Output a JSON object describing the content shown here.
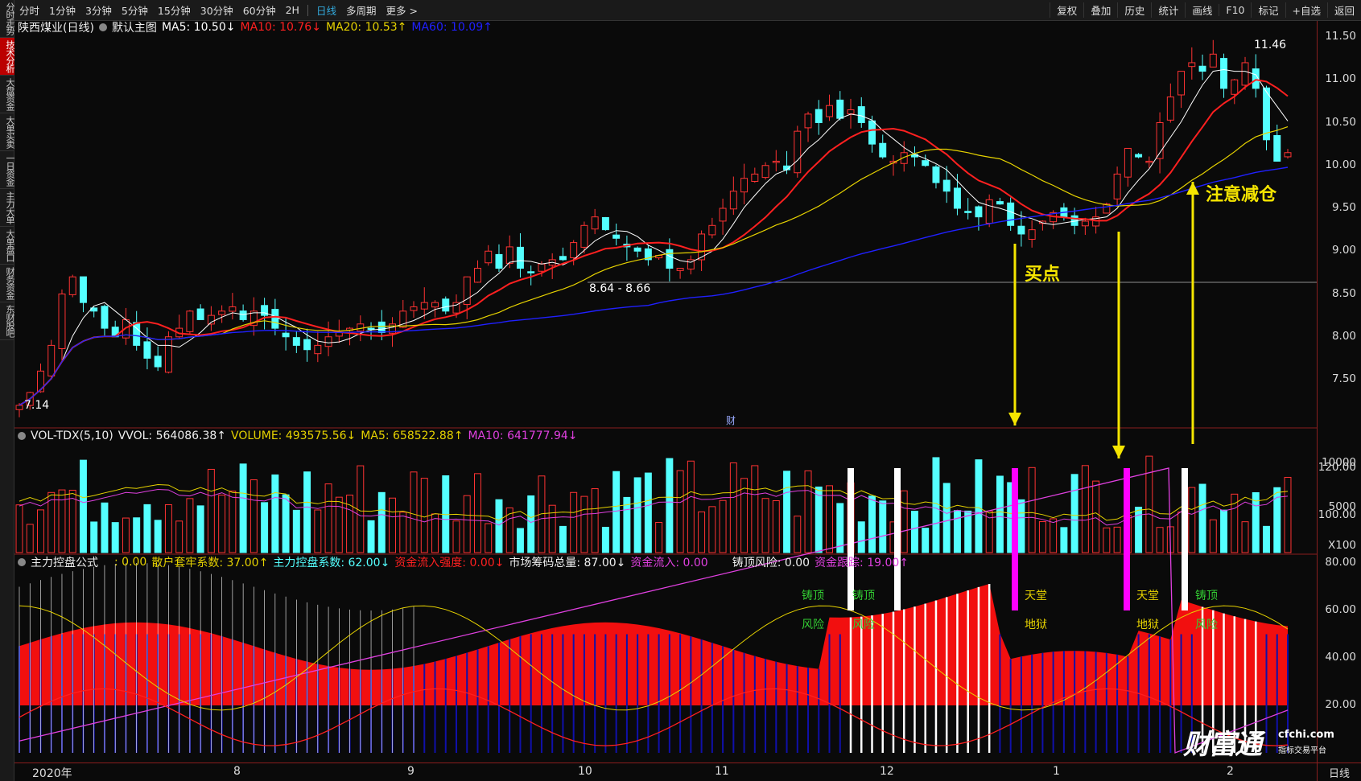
{
  "sidebar": {
    "tabs": [
      {
        "label": "分时走势",
        "active": false
      },
      {
        "label": "技术分析",
        "active": true
      },
      {
        "label": "大盘资金",
        "active": false
      },
      {
        "label": "大单买卖",
        "active": false
      },
      {
        "label": "一日资金",
        "active": false
      },
      {
        "label": "主力大单",
        "active": false
      },
      {
        "label": "大单盘口",
        "active": false
      },
      {
        "label": "财务资金",
        "active": false
      },
      {
        "label": "东财股吧",
        "active": false
      }
    ]
  },
  "toolbar": {
    "periods": [
      "分时",
      "1分钟",
      "3分钟",
      "5分钟",
      "15分钟",
      "30分钟",
      "60分钟",
      "2H",
      "日线",
      "多周期",
      "更多 >"
    ],
    "active_period": "日线",
    "tools": [
      "复权",
      "叠加",
      "历史",
      "统计",
      "画线",
      "F10",
      "标记",
      "+自选",
      "返回"
    ]
  },
  "main_legend": {
    "stock": "陕西煤业(日线)",
    "template": "默认主图",
    "ma5": "MA5: 10.50↓",
    "ma10": "MA10: 10.76↓",
    "ma20": "MA20: 10.53↑",
    "ma60": "MA60: 10.09↑"
  },
  "price_axis": [
    "11.50",
    "11.00",
    "10.50",
    "10.00",
    "9.50",
    "9.00",
    "8.50",
    "8.00",
    "7.50"
  ],
  "price_marks": {
    "high": "11.46",
    "low": "7.14",
    "support": "8.64 - 8.66"
  },
  "annotations": {
    "buy": "买点",
    "reduce": "注意减仓",
    "finance_marker": "财"
  },
  "volume_legend": {
    "name": "VOL-TDX(5,10)",
    "vvol": "VVOL: 564086.38↑",
    "volume": "VOLUME: 493575.56↓",
    "ma5": "MA5: 658522.88↑",
    "ma10": "MA10: 641777.94↓"
  },
  "volume_axis": [
    "10000",
    "5000",
    "X100"
  ],
  "indicator_legend": {
    "name": "主力控盘公式",
    "v0": ": 0.00",
    "retail": "散户套牢系数: 37.00↑",
    "main": "主力控盘系数: 62.00↓",
    "inflow_strength": "资金流入强度: 0.00↓",
    "chips": "市场筹码总量: 87.00↓",
    "inflow": "资金流入: 0.00",
    "top_risk": "铸顶风险: 0.00",
    "tracking": "资金跟踪: 19.00↑"
  },
  "indicator_axis": [
    "120.00",
    "100.00",
    "80.00",
    "60.00",
    "40.00",
    "20.00"
  ],
  "signals": {
    "top": "铸顶",
    "risk": "风险",
    "heaven": "天堂",
    "hell": "地狱"
  },
  "dates": [
    "2020年",
    "8",
    "9",
    "10",
    "11",
    "12",
    "1",
    "2"
  ],
  "timeframe": "日线",
  "watermark": {
    "big": "财富通",
    "site": "cfchi.com",
    "sub": "指标交易平台"
  },
  "colors": {
    "up": "#ff3333",
    "down": "#54ffff",
    "ma5": "#ffffff",
    "ma10": "#ff2020",
    "ma20": "#e6d200",
    "ma60": "#2020ff"
  },
  "chart_data": {
    "type": "candlestick",
    "title": "陕西煤业(日线)",
    "ylim": [
      7.0,
      11.7
    ],
    "closes": [
      7.2,
      7.35,
      7.6,
      7.9,
      8.5,
      8.7,
      8.4,
      8.3,
      8.1,
      8.0,
      8.2,
      7.9,
      7.75,
      7.65,
      8.0,
      8.1,
      8.3,
      8.2,
      8.25,
      8.3,
      8.35,
      8.2,
      8.3,
      8.25,
      8.1,
      8.0,
      7.9,
      7.85,
      7.9,
      8.0,
      8.05,
      8.1,
      8.15,
      8.1,
      8.05,
      8.15,
      8.3,
      8.35,
      8.4,
      8.4,
      8.3,
      8.4,
      8.7,
      8.8,
      9.0,
      8.8,
      9.05,
      8.8,
      8.75,
      8.85,
      8.9,
      8.9,
      9.1,
      9.3,
      9.4,
      9.25,
      9.15,
      9.05,
      9.0,
      8.9,
      8.95,
      8.8,
      8.8,
      8.9,
      9.2,
      9.3,
      9.5,
      9.7,
      9.85,
      9.9,
      10.0,
      10.05,
      9.95,
      10.4,
      10.6,
      10.5,
      10.7,
      10.55,
      10.65,
      10.5,
      10.25,
      10.1,
      10.05,
      10.15,
      10.1,
      10.0,
      9.8,
      9.7,
      9.5,
      9.45,
      9.4,
      9.6,
      9.55,
      9.3,
      9.2,
      9.25,
      9.35,
      9.45,
      9.4,
      9.3,
      9.35,
      9.4,
      9.55,
      9.9,
      10.2,
      10.1,
      10.05,
      10.5,
      10.8,
      11.1,
      11.2,
      11.1,
      11.3,
      10.9,
      11.0,
      11.2,
      10.9,
      10.3,
      10.05,
      10.15
    ],
    "ma": [
      "MA5",
      "MA10",
      "MA20",
      "MA60"
    ]
  }
}
